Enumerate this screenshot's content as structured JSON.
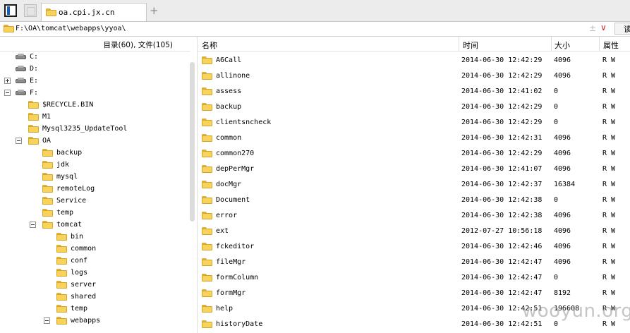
{
  "tabs": [
    {
      "title": "oa.cpi.jx.cn"
    }
  ],
  "tab_add_label": "+",
  "address": {
    "path": "F:\\OA\\tomcat\\webapps\\yyoa\\",
    "plusminus": "±",
    "dropdown": "∨",
    "go_label": "读"
  },
  "left_pane": {
    "summary": "目录(60), 文件(105)",
    "tree": [
      {
        "label": "C:",
        "type": "drive",
        "toggle": "none",
        "depth": 0
      },
      {
        "label": "D:",
        "type": "drive",
        "toggle": "none",
        "depth": 0
      },
      {
        "label": "E:",
        "type": "drive",
        "toggle": "plus",
        "depth": 0
      },
      {
        "label": "F:",
        "type": "drive",
        "toggle": "minus",
        "depth": 0
      },
      {
        "label": "$RECYCLE.BIN",
        "type": "folder",
        "toggle": "none",
        "depth": 1
      },
      {
        "label": "M1",
        "type": "folder",
        "toggle": "none",
        "depth": 1
      },
      {
        "label": "Mysql3235_UpdateTool",
        "type": "folder",
        "toggle": "none",
        "depth": 1
      },
      {
        "label": "OA",
        "type": "folder",
        "toggle": "minus",
        "depth": 1
      },
      {
        "label": "backup",
        "type": "folder",
        "toggle": "none",
        "depth": 2
      },
      {
        "label": "jdk",
        "type": "folder",
        "toggle": "none",
        "depth": 2
      },
      {
        "label": "mysql",
        "type": "folder",
        "toggle": "none",
        "depth": 2
      },
      {
        "label": "remoteLog",
        "type": "folder",
        "toggle": "none",
        "depth": 2
      },
      {
        "label": "Service",
        "type": "folder",
        "toggle": "none",
        "depth": 2
      },
      {
        "label": "temp",
        "type": "folder",
        "toggle": "none",
        "depth": 2
      },
      {
        "label": "tomcat",
        "type": "folder",
        "toggle": "minus",
        "depth": 2
      },
      {
        "label": "bin",
        "type": "folder",
        "toggle": "none",
        "depth": 3
      },
      {
        "label": "common",
        "type": "folder",
        "toggle": "none",
        "depth": 3
      },
      {
        "label": "conf",
        "type": "folder",
        "toggle": "none",
        "depth": 3
      },
      {
        "label": "logs",
        "type": "folder",
        "toggle": "none",
        "depth": 3
      },
      {
        "label": "server",
        "type": "folder",
        "toggle": "none",
        "depth": 3
      },
      {
        "label": "shared",
        "type": "folder",
        "toggle": "none",
        "depth": 3
      },
      {
        "label": "temp",
        "type": "folder",
        "toggle": "none",
        "depth": 3
      },
      {
        "label": "webapps",
        "type": "folder",
        "toggle": "minus",
        "depth": 3
      }
    ]
  },
  "file_list": {
    "columns": [
      "名称",
      "时间",
      "大小",
      "属性"
    ],
    "rows": [
      {
        "name": "A6Call",
        "time": "2014-06-30 12:42:29",
        "size": "4096",
        "attr": "R W"
      },
      {
        "name": "allinone",
        "time": "2014-06-30 12:42:29",
        "size": "4096",
        "attr": "R W"
      },
      {
        "name": "assess",
        "time": "2014-06-30 12:41:02",
        "size": "0",
        "attr": "R W"
      },
      {
        "name": "backup",
        "time": "2014-06-30 12:42:29",
        "size": "0",
        "attr": "R W"
      },
      {
        "name": "clientsncheck",
        "time": "2014-06-30 12:42:29",
        "size": "0",
        "attr": "R W"
      },
      {
        "name": "common",
        "time": "2014-06-30 12:42:31",
        "size": "4096",
        "attr": "R W"
      },
      {
        "name": "common270",
        "time": "2014-06-30 12:42:29",
        "size": "4096",
        "attr": "R W"
      },
      {
        "name": "depPerMgr",
        "time": "2014-06-30 12:41:07",
        "size": "4096",
        "attr": "R W"
      },
      {
        "name": "docMgr",
        "time": "2014-06-30 12:42:37",
        "size": "16384",
        "attr": "R W"
      },
      {
        "name": "Document",
        "time": "2014-06-30 12:42:38",
        "size": "0",
        "attr": "R W"
      },
      {
        "name": "error",
        "time": "2014-06-30 12:42:38",
        "size": "4096",
        "attr": "R W"
      },
      {
        "name": "ext",
        "time": "2012-07-27 10:56:18",
        "size": "4096",
        "attr": "R W"
      },
      {
        "name": "fckeditor",
        "time": "2014-06-30 12:42:46",
        "size": "4096",
        "attr": "R W"
      },
      {
        "name": "fileMgr",
        "time": "2014-06-30 12:42:47",
        "size": "4096",
        "attr": "R W"
      },
      {
        "name": "formColumn",
        "time": "2014-06-30 12:42:47",
        "size": "0",
        "attr": "R W"
      },
      {
        "name": "formMgr",
        "time": "2014-06-30 12:42:47",
        "size": "8192",
        "attr": "R W"
      },
      {
        "name": "help",
        "time": "2014-06-30 12:42:51",
        "size": "196608",
        "attr": "R W"
      },
      {
        "name": "historyDate",
        "time": "2014-06-30 12:42:51",
        "size": "0",
        "attr": "R W"
      }
    ]
  },
  "watermark": "wooyun.org",
  "colors": {
    "folder": "#f7d35c",
    "folder_border": "#d3a52b",
    "accent": "#1a5fb4",
    "dropdown_arrow": "#c62828"
  }
}
